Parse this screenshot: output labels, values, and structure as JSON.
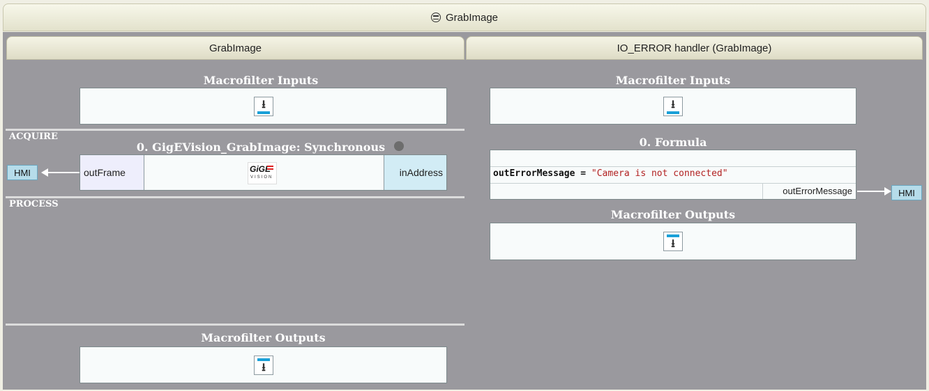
{
  "window": {
    "title": "GrabImage",
    "title_icon": "refresh-cycle-icon"
  },
  "left_column": {
    "header": "GrabImage",
    "inputs_label": "Macrofilter Inputs",
    "acquire_label": "ACQUIRE",
    "filter": {
      "title": "0. GigEVision_GrabImage: Synchronous",
      "output_port": "outFrame",
      "input_port": "inAddress",
      "logo_text": "GiGE",
      "logo_subtext": "VISION",
      "hmi_label": "HMI"
    },
    "process_label": "PROCESS",
    "outputs_label": "Macrofilter Outputs"
  },
  "right_column": {
    "header": "IO_ERROR handler (GrabImage)",
    "inputs_label": "Macrofilter Inputs",
    "formula": {
      "title": "0. Formula",
      "code_name": "outErrorMessage",
      "code_op": " = ",
      "code_value": "\"Camera is not connected\"",
      "output_port": "outErrorMessage",
      "hmi_label": "HMI"
    },
    "outputs_label": "Macrofilter Outputs"
  },
  "colors": {
    "canvas": "#9a999e",
    "accent": "#1aa0d8",
    "hmi": "#b6dcea",
    "string": "#b22222"
  }
}
